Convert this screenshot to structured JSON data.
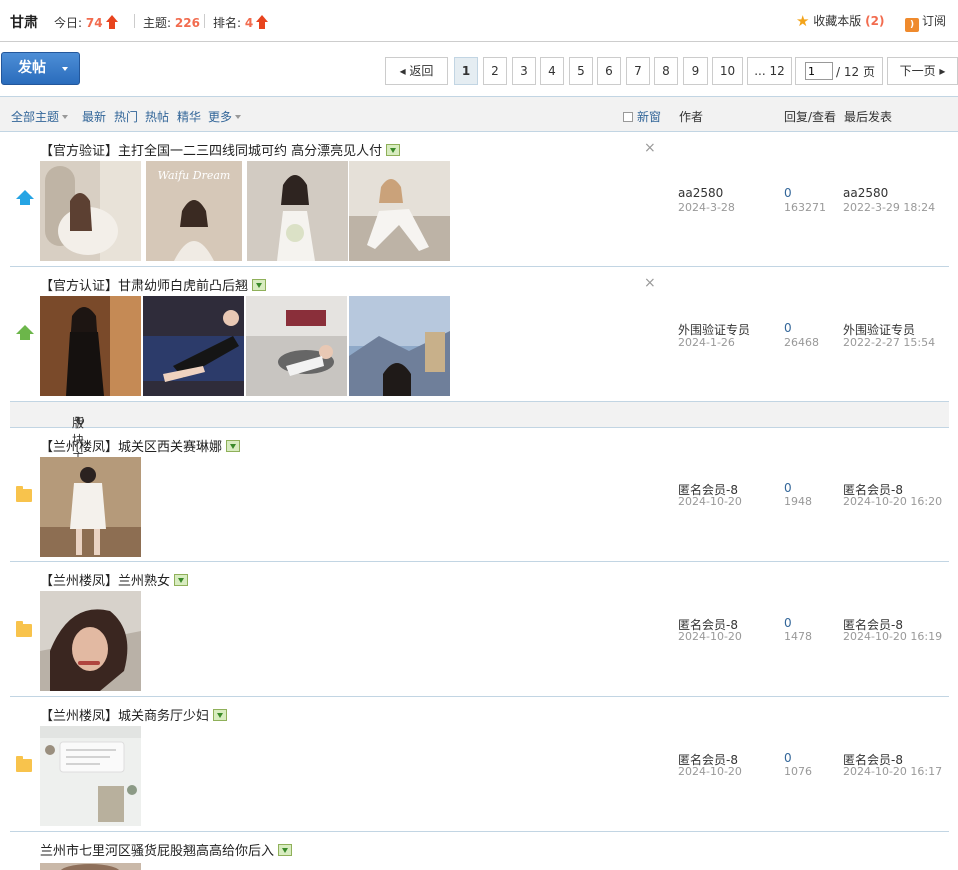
{
  "header": {
    "forum_name": "甘肃",
    "today_label": "今日:",
    "today_value": "74",
    "topics_label": "主题:",
    "topics_value": "226",
    "rank_label": "排名:",
    "rank_value": "4",
    "favorite_label": "收藏本版",
    "favorite_count": "(2)",
    "subscribe_label": "订阅"
  },
  "toolbar": {
    "post_label": "发帖",
    "prev_label": "返回",
    "pages": [
      "1",
      "2",
      "3",
      "4",
      "5",
      "6",
      "7",
      "8",
      "9",
      "10",
      "... 12"
    ],
    "current_page": "1",
    "page_input_value": "1",
    "page_total": "/ 12 页",
    "next_label": "下一页"
  },
  "filters": {
    "all": "全部主题",
    "latest": "最新",
    "hot": "热门",
    "hot_posts": "热帖",
    "digest": "精华",
    "more": "更多",
    "new_window": "新窗",
    "col_author": "作者",
    "col_replies": "回复/查看",
    "col_last": "最后发表"
  },
  "section_label": "版块主题",
  "threads": [
    {
      "title": "【官方验证】主打全国一二三四线同城可约 高分漂亮见人付",
      "author": "aa2580",
      "date": "2024-3-28",
      "replies": "0",
      "views": "163271",
      "last_user": "aa2580",
      "last_time": "2022-3-29 18:24",
      "icon": "pin-blue"
    },
    {
      "title": "【官方认证】甘肃幼师白虎前凸后翘",
      "author": "外围验证专员",
      "date": "2024-1-26",
      "replies": "0",
      "views": "26468",
      "last_user": "外围验证专员",
      "last_time": "2022-2-27 15:54",
      "icon": "pin-green"
    },
    {
      "title": "【兰州楼凤】城关区西关赛琳娜",
      "author": "匿名会员-8",
      "date": "2024-10-20",
      "replies": "0",
      "views": "1948",
      "last_user": "匿名会员-8",
      "last_time": "2024-10-20 16:20",
      "icon": "folder"
    },
    {
      "title": "【兰州楼凤】兰州熟女",
      "author": "匿名会员-8",
      "date": "2024-10-20",
      "replies": "0",
      "views": "1478",
      "last_user": "匿名会员-8",
      "last_time": "2024-10-20 16:19",
      "icon": "folder"
    },
    {
      "title": "【兰州楼凤】城关商务厅少妇",
      "author": "匿名会员-8",
      "date": "2024-10-20",
      "replies": "0",
      "views": "1076",
      "last_user": "匿名会员-8",
      "last_time": "2024-10-20 16:17",
      "icon": "folder"
    },
    {
      "title": "兰州市七里河区骚货屁股翘高高给你后入",
      "icon": "folder"
    }
  ],
  "thumb_text": "Waifu Dream",
  "colors": {
    "link": "#336699",
    "accent": "#f26c4f",
    "border": "#c2d5e3"
  }
}
